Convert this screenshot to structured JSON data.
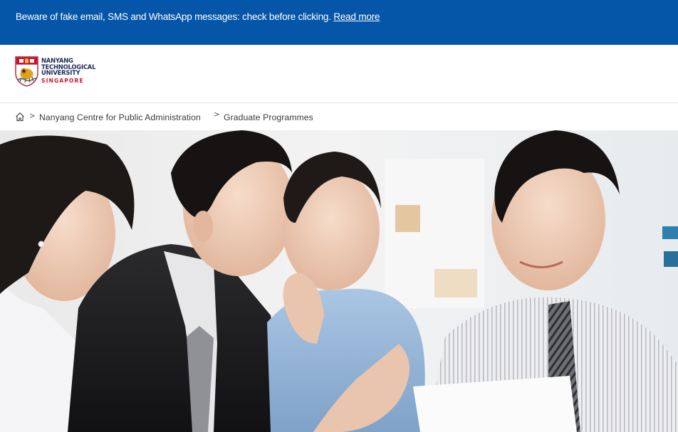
{
  "alert": {
    "message": "Beware of fake email, SMS and WhatsApp messages: check before clicking.",
    "link_label": "Read more"
  },
  "logo": {
    "lines": [
      "NANYANG",
      "TECHNOLOGICAL",
      "UNIVERSITY"
    ],
    "subline": "SINGAPORE",
    "colors": {
      "navy": "#1e2a5a",
      "red": "#d6142e"
    }
  },
  "breadcrumb": {
    "home_icon": "home-icon",
    "separator": ">",
    "items": [
      {
        "label": "Nanyang Centre for Public Administration",
        "link": true
      },
      {
        "label": "Graduate Programmes",
        "link": false
      }
    ]
  },
  "hero": {
    "icon": "photo-four-students-discussing"
  },
  "colors": {
    "alert_bg": "#0556a8",
    "alert_text": "#ffffff",
    "breadcrumb_text": "#3a3a3a"
  }
}
